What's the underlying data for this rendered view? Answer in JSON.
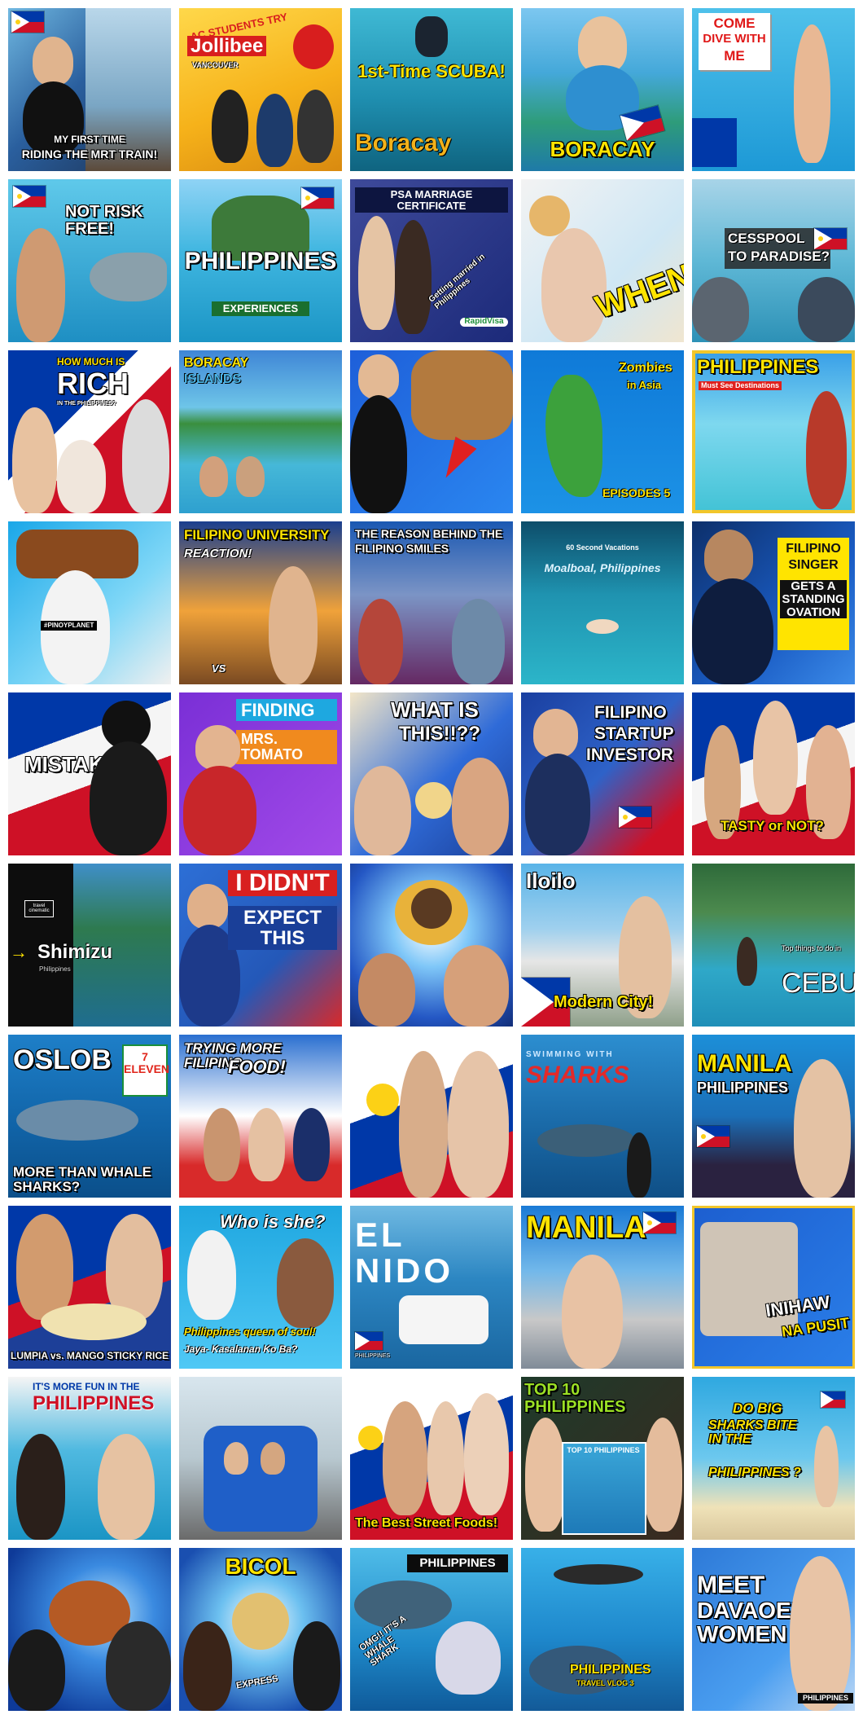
{
  "thumbnails": [
    {
      "line1": "",
      "line2": "MY FIRST TIME",
      "line3": "RIDING THE MRT TRAIN!"
    },
    {
      "line1": "AC STUDENTS TRY",
      "line2": "Jollibee",
      "line3": "VANCOUVER"
    },
    {
      "line1": "1st-Time SCUBA!",
      "line2": "Boracay",
      "line3": ""
    },
    {
      "line1": "",
      "line2": "BORACAY",
      "line3": ""
    },
    {
      "line1": "COME",
      "line2": "DIVE WITH",
      "line3": "ME"
    },
    {
      "line1": "NOT RISK FREE!",
      "line2": "",
      "line3": ""
    },
    {
      "line1": "PHILIPPINES",
      "line2": "EXPERIENCES",
      "line3": ""
    },
    {
      "line1": "PSA MARRIAGE CERTIFICATE",
      "line2": "Getting married in Philippines",
      "line3": "RapidVisa"
    },
    {
      "line1": "WHEN?",
      "line2": "",
      "line3": ""
    },
    {
      "line1": "CESSPOOL",
      "line2": "TO PARADISE?",
      "line3": ""
    },
    {
      "line1": "HOW MUCH IS",
      "line2": "RICH",
      "line3": "IN THE PHILIPPINES?"
    },
    {
      "line1": "BORACAY",
      "line2": "ISLANDS",
      "line3": ""
    },
    {
      "line1": "",
      "line2": "",
      "line3": ""
    },
    {
      "line1": "Zombies",
      "line2": "in Asia",
      "line3": "EPISODES 5"
    },
    {
      "line1": "PHILIPPINES",
      "line2": "Must See Destinations",
      "line3": ""
    },
    {
      "line1": "#PINOYPLANET",
      "line2": "",
      "line3": ""
    },
    {
      "line1": "FILIPINO UNIVERSITY",
      "line2": "REACTION!",
      "line3": "VS"
    },
    {
      "line1": "THE REASON BEHIND THE",
      "line2": "FILIPINO SMILES",
      "line3": ""
    },
    {
      "line1": "60 Second Vacations",
      "line2": "Moalboal, Philippines",
      "line3": ""
    },
    {
      "line1": "FILIPINO",
      "line2": "SINGER",
      "line3": "GETS A STANDING OVATION"
    },
    {
      "line1": "MISTAKE?",
      "line2": "",
      "line3": ""
    },
    {
      "line1": "FINDING",
      "line2": "MRS. TOMATO",
      "line3": ""
    },
    {
      "line1": "WHAT IS",
      "line2": "THIS!!??",
      "line3": ""
    },
    {
      "line1": "FILIPINO",
      "line2": "STARTUP",
      "line3": "INVESTOR"
    },
    {
      "line1": "TASTY or NOT?",
      "line2": "",
      "line3": ""
    },
    {
      "line1": "travel cinematic",
      "line2": "Shimizu",
      "line3": "Philippines"
    },
    {
      "line1": "I DIDN'T",
      "line2": "EXPECT THIS",
      "line3": ""
    },
    {
      "line1": "",
      "line2": "",
      "line3": ""
    },
    {
      "line1": "Iloilo",
      "line2": "Modern City!",
      "line3": ""
    },
    {
      "line1": "Top things to do in",
      "line2": "CEBU",
      "line3": ""
    },
    {
      "line1": "OSLOB",
      "line2": "7 ELEVEN",
      "line3": "MORE THAN WHALE SHARKS?"
    },
    {
      "line1": "TRYING MORE FILIPINO",
      "line2": "FOOD!",
      "line3": ""
    },
    {
      "line1": "",
      "line2": "",
      "line3": ""
    },
    {
      "line1": "SWIMMING WITH",
      "line2": "SHARKS",
      "line3": ""
    },
    {
      "line1": "MANILA",
      "line2": "PHILIPPINES",
      "line3": ""
    },
    {
      "line1": "LUMPIA vs. MANGO STICKY RICE",
      "line2": "",
      "line3": ""
    },
    {
      "line1": "Who is she?",
      "line2": "Philippines queen of soul!",
      "line3": "Jaya- Kasalanan Ko Ba?"
    },
    {
      "line1": "EL NIDO",
      "line2": "PHILIPPINES",
      "line3": ""
    },
    {
      "line1": "MANILA",
      "line2": "",
      "line3": ""
    },
    {
      "line1": "INIHAW",
      "line2": "NA PUSIT",
      "line3": ""
    },
    {
      "line1": "IT'S MORE FUN IN THE",
      "line2": "PHILIPPINES",
      "line3": ""
    },
    {
      "line1": "",
      "line2": "",
      "line3": ""
    },
    {
      "line1": "The Best Street Foods!",
      "line2": "",
      "line3": ""
    },
    {
      "line1": "TOP 10 PHILIPPINES",
      "line2": "TOP 10 PHILIPPINES",
      "line3": ""
    },
    {
      "line1": "DO BIG",
      "line2": "SHARKS BITE IN THE",
      "line3": "PHILIPPINES ?"
    },
    {
      "line1": "",
      "line2": "",
      "line3": ""
    },
    {
      "line1": "BICOL",
      "line2": "EXPRESS",
      "line3": ""
    },
    {
      "line1": "PHILIPPINES",
      "line2": "OMG!! IT'S A WHALE SHARK",
      "line3": ""
    },
    {
      "line1": "PHILIPPINES",
      "line2": "TRAVEL VLOG 3",
      "line3": ""
    },
    {
      "line1": "MEET",
      "line2": "DAVAOEÑA WOMEN",
      "line3": "PHILIPPINES"
    }
  ],
  "colors": {
    "ph_blue": "#0038a8",
    "ph_red": "#ce1126",
    "ph_yellow": "#fcd116",
    "ocean": "#1e90c8",
    "sky": "#5ec8f0"
  }
}
